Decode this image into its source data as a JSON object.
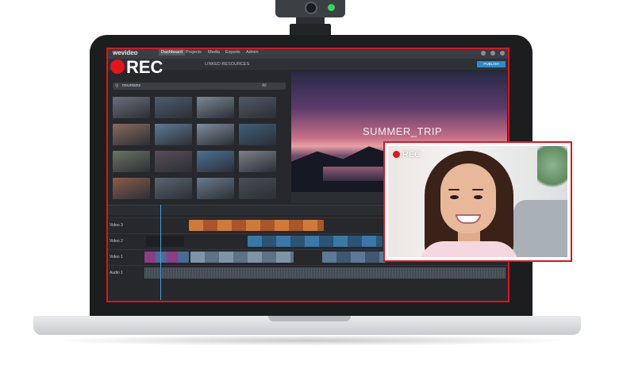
{
  "recording": {
    "screen_label": "REC",
    "webcam_label": "REC",
    "indicator_color": "#e8141c",
    "frame_color": "#e0141b"
  },
  "app": {
    "logo_text": "wevideo",
    "nav_tabs": [
      {
        "label": "Dashboard",
        "active": true
      },
      {
        "label": "Projects",
        "active": false
      },
      {
        "label": "Media",
        "active": false
      },
      {
        "label": "Exports",
        "active": false
      },
      {
        "label": "Admin",
        "active": false
      }
    ],
    "sub_header": "LINKED RESOURCES",
    "publish_button": "PUBLISH"
  },
  "media": {
    "search_value": "mountains",
    "filter_value": "All",
    "thumbnails": [
      {
        "name": "thumb-1",
        "color": "#6b6f7a"
      },
      {
        "name": "thumb-2",
        "color": "#4d5d6e"
      },
      {
        "name": "thumb-3",
        "color": "#7d8893"
      },
      {
        "name": "thumb-4",
        "color": "#505965"
      },
      {
        "name": "thumb-5",
        "color": "#8b6a5d"
      },
      {
        "name": "thumb-6",
        "color": "#607a95"
      },
      {
        "name": "thumb-7",
        "color": "#7f8c9c"
      },
      {
        "name": "thumb-8",
        "color": "#3f5f7a"
      },
      {
        "name": "thumb-9",
        "color": "#6c7463"
      },
      {
        "name": "thumb-10",
        "color": "#5a4d57"
      },
      {
        "name": "thumb-11",
        "color": "#4c7196"
      },
      {
        "name": "thumb-12",
        "color": "#7a8288"
      },
      {
        "name": "thumb-13",
        "color": "#8a5d4c"
      },
      {
        "name": "thumb-14",
        "color": "#596570"
      },
      {
        "name": "thumb-15",
        "color": "#6a7b8a"
      },
      {
        "name": "thumb-16",
        "color": "#4a4f55"
      }
    ]
  },
  "preview": {
    "title": "SUMMER_TRIP"
  },
  "timeline": {
    "tracks": [
      "Video 3",
      "Video 2",
      "Video 1",
      "Audio 1"
    ]
  }
}
